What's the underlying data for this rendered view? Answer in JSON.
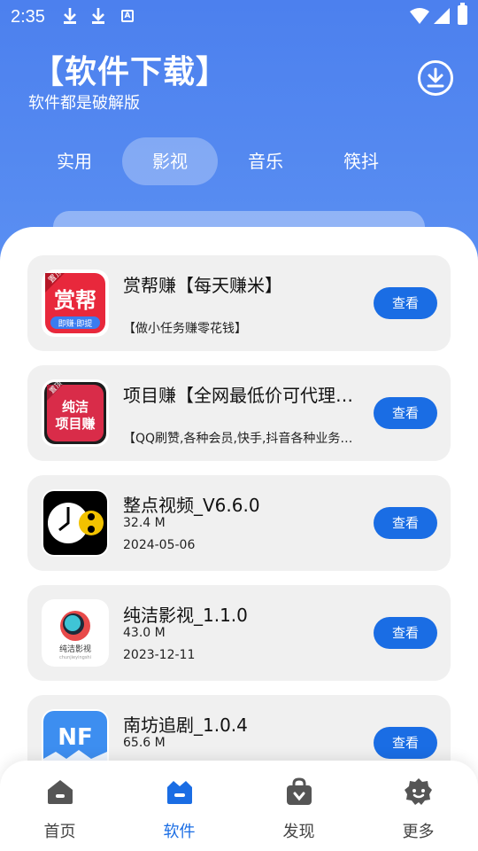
{
  "status": {
    "time": "2:35"
  },
  "header": {
    "title": "【软件下载】",
    "subtitle": "软件都是破解版"
  },
  "tabs": [
    {
      "label": "实用",
      "active": false
    },
    {
      "label": "影视",
      "active": true
    },
    {
      "label": "音乐",
      "active": false
    },
    {
      "label": "筷抖",
      "active": false
    }
  ],
  "apps": [
    {
      "name": "赏帮赚【每天赚米】",
      "desc": "【做小任务赚零花钱】",
      "size": "",
      "date": "",
      "button": "查看",
      "icon_text": "赏帮",
      "icon_badge": "置顶",
      "icon_sub": "即赚·即提",
      "icon_color": "#e8283c"
    },
    {
      "name": "项目赚【全网最低价可代理投放】",
      "desc": "【QQ刷赞,各种会员,快手,抖音各种业务都有】",
      "size": "",
      "date": "",
      "button": "查看",
      "icon_text_1": "纯洁",
      "icon_text_2": "项目赚",
      "icon_badge": "置顶",
      "icon_color": "#d92c49"
    },
    {
      "name": "整点视频_V6.6.0",
      "size": "32.4 M",
      "date": "2024-05-06",
      "button": "查看",
      "icon_color": "#000000"
    },
    {
      "name": "纯洁影视_1.1.0",
      "size": "43.0 M",
      "date": "2023-12-11",
      "button": "查看",
      "icon_caption": "纯洁影视",
      "icon_caption_sub": "chunjieyingshi"
    },
    {
      "name": "南坊追剧_1.0.4",
      "size": "65.6 M",
      "date": "",
      "button": "查看",
      "icon_text": "NF",
      "icon_color": "#3d8ef0"
    }
  ],
  "nav": [
    {
      "label": "首页",
      "icon": "home-icon",
      "active": false
    },
    {
      "label": "软件",
      "icon": "software-icon",
      "active": true
    },
    {
      "label": "发现",
      "icon": "discover-bag-icon",
      "active": false
    },
    {
      "label": "更多",
      "icon": "more-face-icon",
      "active": false
    }
  ],
  "colors": {
    "accent": "#1a6de4",
    "header_bg": "#4f86f0",
    "card_bg": "#f0f0f0"
  }
}
